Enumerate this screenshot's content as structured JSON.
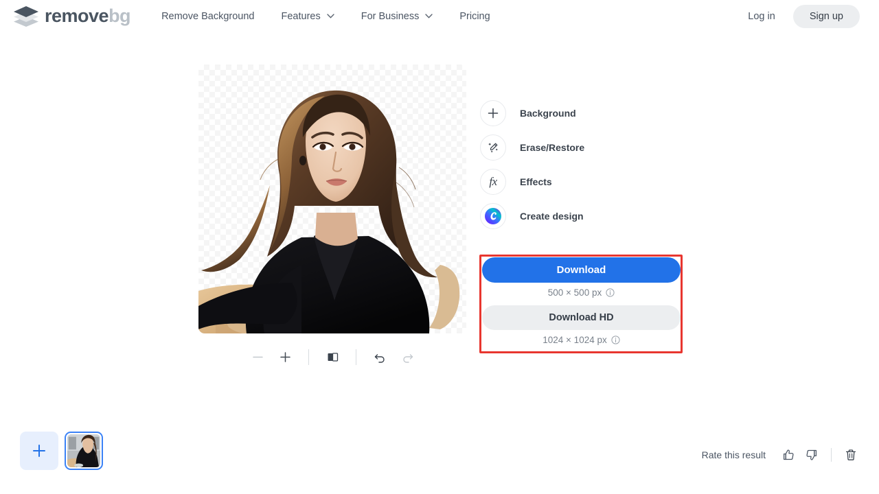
{
  "header": {
    "logo": {
      "icon": "layers-diamond-icon",
      "text_dark": "remove",
      "text_light": "bg"
    },
    "nav": [
      {
        "label": "Remove Background",
        "has_caret": false,
        "icon": ""
      },
      {
        "label": "Features",
        "has_caret": true,
        "icon": "chevron-down-icon"
      },
      {
        "label": "For Business",
        "has_caret": true,
        "icon": "chevron-down-icon"
      },
      {
        "label": "Pricing",
        "has_caret": false,
        "icon": ""
      }
    ],
    "login_label": "Log in",
    "signup_label": "Sign up"
  },
  "canvas": {
    "alt": "Portrait of a woman with long brown hair wearing a black coat, leaning on a wooden table with a cup, background removed showing transparency checkerboard",
    "transparent": true
  },
  "zoom_toolbar": {
    "buttons": [
      {
        "name": "zoom-out-button",
        "icon": "minus-icon",
        "disabled": true
      },
      {
        "name": "zoom-in-button",
        "icon": "plus-icon",
        "disabled": false
      },
      {
        "name": "compare-toggle-button",
        "icon": "split-compare-icon",
        "disabled": false
      },
      {
        "name": "undo-button",
        "icon": "undo-arrow-icon",
        "disabled": false
      },
      {
        "name": "redo-button",
        "icon": "redo-arrow-icon",
        "disabled": true
      }
    ]
  },
  "tools": [
    {
      "label": "Background",
      "icon": "plus-icon"
    },
    {
      "label": "Erase/Restore",
      "icon": "magic-brush-icon"
    },
    {
      "label": "Effects",
      "icon": "fx-icon",
      "glyph": "fx"
    },
    {
      "label": "Create design",
      "icon": "canva-logo-icon"
    }
  ],
  "download": {
    "highlighted": true,
    "highlight_color": "#e8362f",
    "primary_label": "Download",
    "primary_color": "#2272e8",
    "primary_resolution": "500 × 500 px",
    "hd_label": "Download HD",
    "hd_resolution": "1024 × 1024 px",
    "info_icon": "info-circle-icon"
  },
  "bottom_bar": {
    "add_image_icon": "plus-icon",
    "thumbnail_selected": true,
    "rate_label": "Rate this result",
    "thumbs_up_icon": "thumbs-up-icon",
    "thumbs_down_icon": "thumbs-down-icon",
    "delete_icon": "trash-icon"
  }
}
